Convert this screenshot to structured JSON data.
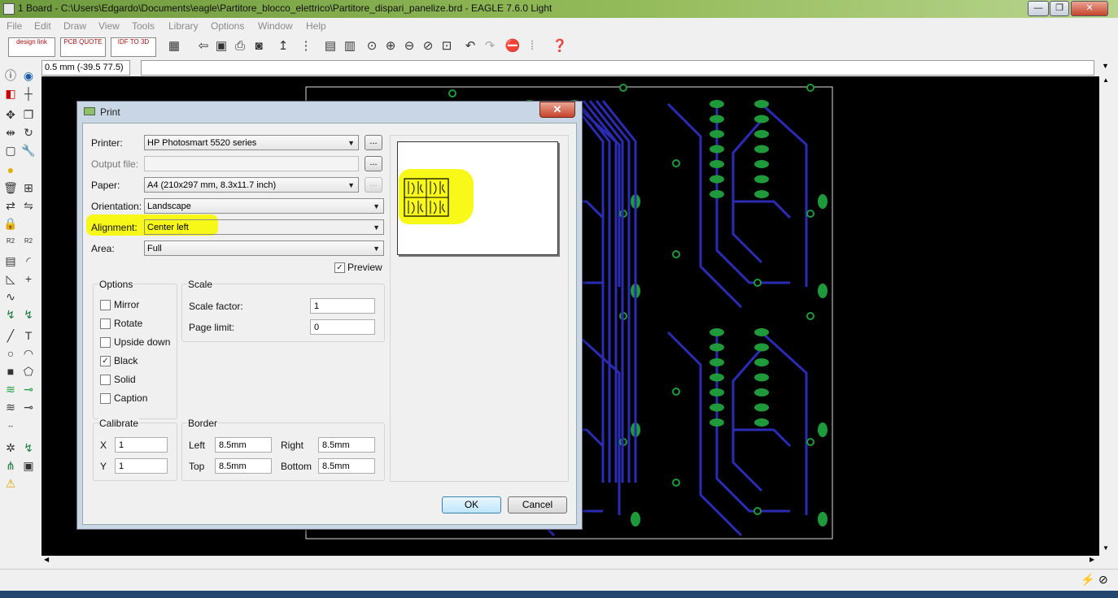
{
  "window": {
    "title": "1 Board - C:\\Users\\Edgardo\\Documents\\eagle\\Partitore_blocco_elettrico\\Partitore_dispari_panelize.brd - EAGLE 7.6.0 Light",
    "minimize": "—",
    "maximize": "❐",
    "close": "✕"
  },
  "menu": [
    "File",
    "Edit",
    "Draw",
    "View",
    "Tools",
    "Library",
    "Options",
    "Window",
    "Help"
  ],
  "toolbar": {
    "designlink": "design link",
    "pcbquote": "PCB QUOTE",
    "idfto3d": "IDF TO 3D"
  },
  "coordinate": "0.5 mm (-39.5 77.5)",
  "dialog": {
    "title": "Print",
    "printer_label": "Printer:",
    "printer_value": "HP Photosmart 5520 series",
    "output_label": "Output file:",
    "output_value": "",
    "paper_label": "Paper:",
    "paper_value": "A4 (210x297 mm, 8.3x11.7 inch)",
    "orientation_label": "Orientation:",
    "orientation_value": "Landscape",
    "alignment_label": "Alignment:",
    "alignment_value": "Center left",
    "area_label": "Area:",
    "area_value": "Full",
    "browse": "...",
    "preview_label": "Preview",
    "preview_checked": true,
    "options_title": "Options",
    "options": [
      {
        "label": "Mirror",
        "checked": false
      },
      {
        "label": "Rotate",
        "checked": false
      },
      {
        "label": "Upside down",
        "checked": false
      },
      {
        "label": "Black",
        "checked": true
      },
      {
        "label": "Solid",
        "checked": false
      },
      {
        "label": "Caption",
        "checked": false
      }
    ],
    "scale_title": "Scale",
    "scale_factor_label": "Scale factor:",
    "scale_factor_value": "1",
    "page_limit_label": "Page limit:",
    "page_limit_value": "0",
    "calibrate_title": "Calibrate",
    "cal_x_label": "X",
    "cal_x_value": "1",
    "cal_y_label": "Y",
    "cal_y_value": "1",
    "border_title": "Border",
    "left_label": "Left",
    "left_value": "8.5mm",
    "right_label": "Right",
    "right_value": "8.5mm",
    "top_label": "Top",
    "top_value": "8.5mm",
    "bottom_label": "Bottom",
    "bottom_value": "8.5mm",
    "ok": "OK",
    "cancel": "Cancel"
  },
  "colors": {
    "trace": "#2b2bb5",
    "pad": "#1f9a3a",
    "highlight": "#f7f700",
    "canvas": "#000000"
  }
}
